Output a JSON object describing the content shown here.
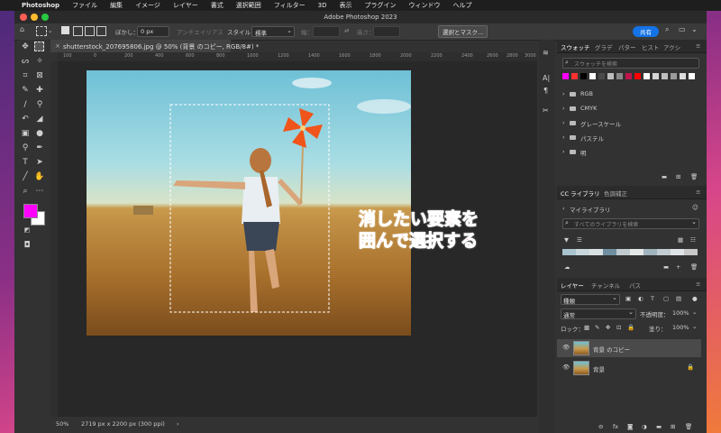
{
  "menubar": {
    "apple": "",
    "app": "Photoshop",
    "items": [
      "ファイル",
      "編集",
      "イメージ",
      "レイヤー",
      "書式",
      "選択範囲",
      "フィルター",
      "3D",
      "表示",
      "プラグイン",
      "ウィンドウ",
      "ヘルプ"
    ]
  },
  "window": {
    "title": "Adobe Photoshop 2023",
    "traffic_colors": [
      "#ff5f57",
      "#febc2e",
      "#28c840"
    ]
  },
  "options": {
    "feather_label": "ぼかし：",
    "feather_value": "0 px",
    "antialias": "アンチエイリアス",
    "style_label": "スタイル：",
    "style_value": "標準",
    "width_label": "幅：",
    "height_label": "高さ：",
    "select_mask": "選択とマスク...",
    "share": "共有"
  },
  "document": {
    "tab_title": "shutterstock_207695806.jpg @ 50% (背景 のコピー, RGB/8#) *",
    "close": "×",
    "zoom": "50%",
    "doc_info": "2719 px x 2200 px (300 ppi)",
    "ruler_ticks": [
      "100",
      "0",
      "200",
      "400",
      "600",
      "800",
      "1000",
      "1200",
      "1400",
      "1600",
      "1800",
      "2000",
      "2200",
      "2400",
      "2600",
      "2800",
      "3000"
    ]
  },
  "annotation": {
    "line1": "消したい要素を",
    "line2": "囲んで選択する",
    "color": "#ff3cc8"
  },
  "swatches_panel": {
    "tabs": [
      "スウォッチ",
      "グラデ",
      "パター",
      "ヒスト",
      "アクシ"
    ],
    "search_placeholder": "スウォッチを検索",
    "colors": [
      "#ff00ff",
      "#ff3030",
      "#000000",
      "#ffffff",
      "#4a4a4a",
      "#bdbdbd",
      "#888888",
      "#c0144c",
      "#ff0000",
      "#ffffff",
      "#d6d6d6",
      "#bfbfbf",
      "#9a9a9a",
      "#dcdcdc",
      "#ffffff"
    ],
    "groups": [
      "RGB",
      "CMYK",
      "グレースケール",
      "パステル",
      "明"
    ]
  },
  "library_panel": {
    "tabs": [
      "CC ライブラリ",
      "色調補正"
    ],
    "my_library": "マイライブラリ",
    "search_placeholder": "すべてのライブラリを検索",
    "palette": [
      "#a9c3cf",
      "#c9d6dc",
      "#d9e1e3",
      "#6f8fa0",
      "#bfcbcf",
      "#e4e8e6",
      "#9fb3bd",
      "#c1ccd0",
      "#dfe5e6",
      "#c8c8c8"
    ]
  },
  "layers_panel": {
    "tabs": [
      "レイヤー",
      "チャンネル",
      "パス"
    ],
    "filter_label": "種類",
    "blend_mode": "通常",
    "opacity_label": "不透明度：",
    "opacity_value": "100%",
    "lock_label": "ロック：",
    "fill_label": "塗り：",
    "fill_value": "100%",
    "layers": [
      {
        "name": "背景 のコピー",
        "selected": true
      },
      {
        "name": "背景",
        "selected": false
      }
    ],
    "footer_icons": [
      "link-icon",
      "fx-icon",
      "mask-icon",
      "adjustment-icon",
      "folder-icon",
      "new-layer-icon",
      "trash-icon"
    ]
  },
  "toolbar": {
    "foreground_color": "#ff00ff",
    "background_color": "#ffffff"
  }
}
